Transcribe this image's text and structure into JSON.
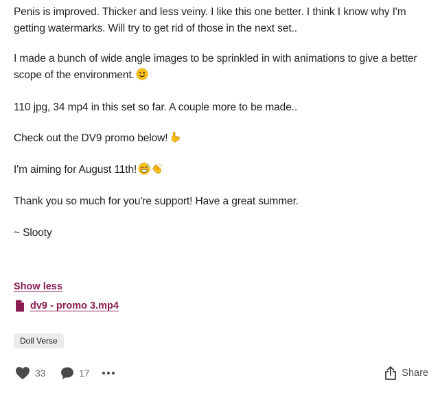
{
  "post": {
    "paragraphs": [
      "Penis is improved. Thicker and less veiny. I like this one better. I think I know why I'm getting watermarks. Will try to get rid of those in the next set..",
      "I made a bunch of wide angle images to be sprinkled in with animations to give a better scope of the environment.",
      "110 jpg, 34 mp4 in this set so far. A couple more to be made..",
      "Check out the DV9 promo below!",
      "I'm aiming for August 11th!",
      "Thank you so much for you're support! Have a great summer.",
      "~ Slooty"
    ],
    "emojis": {
      "wink": "winking-face-emoji",
      "point_down": "backhand-index-pointing-down-emoji",
      "grin_sweat": "grinning-face-with-sweat-emoji",
      "clap": "clapping-hands-emoji"
    }
  },
  "show_less_label": "Show less",
  "attachment": {
    "file_name": "dv9 - promo 3.mp4",
    "icon": "file-icon"
  },
  "tags": [
    "Doll Verse"
  ],
  "actions": {
    "like_count": "33",
    "comment_count": "17",
    "share_label": "Share"
  },
  "colors": {
    "link": "#8a1c52",
    "text": "#1e1e1e",
    "muted": "#6b6b6b",
    "tag_bg": "#ececec"
  }
}
